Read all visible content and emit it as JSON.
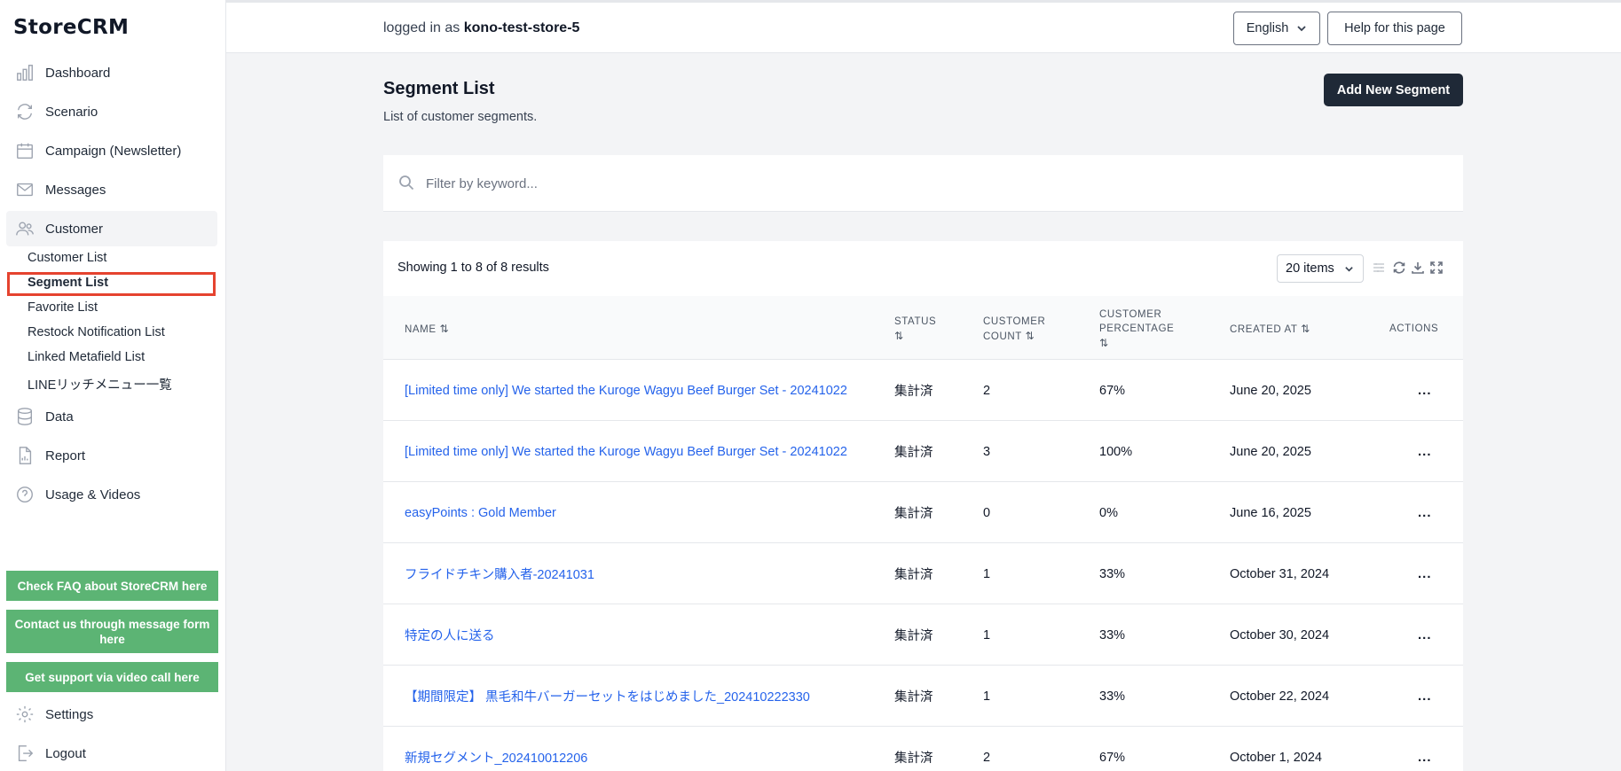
{
  "app": {
    "logo": "StoreCRM"
  },
  "sidebar": {
    "nav": [
      {
        "label": "Dashboard",
        "icon": "bar-chart-icon"
      },
      {
        "label": "Scenario",
        "icon": "refresh-icon"
      },
      {
        "label": "Campaign (Newsletter)",
        "icon": "calendar-icon"
      },
      {
        "label": "Messages",
        "icon": "mail-icon"
      },
      {
        "label": "Customer",
        "icon": "users-icon"
      }
    ],
    "customer_sub": [
      "Customer List",
      "Segment List",
      "Favorite List",
      "Restock Notification List",
      "Linked Metafield List",
      "LINEリッチメニュー一覧"
    ],
    "nav2": [
      {
        "label": "Data",
        "icon": "database-icon"
      },
      {
        "label": "Report",
        "icon": "document-chart-icon"
      },
      {
        "label": "Usage & Videos",
        "icon": "question-circle-icon"
      }
    ],
    "support_buttons": [
      "Check FAQ about StoreCRM here",
      "Contact us through message form here",
      "Get support via video call here"
    ],
    "bottom": [
      {
        "label": "Settings",
        "icon": "gear-icon"
      },
      {
        "label": "Logout",
        "icon": "logout-icon"
      }
    ]
  },
  "topbar": {
    "logged_prefix": "logged in as",
    "store": "kono-test-store-5",
    "language": "English",
    "help": "Help for this page"
  },
  "main": {
    "title": "Segment List",
    "subtitle": "List of customer segments.",
    "add_button": "Add New Segment",
    "filter_placeholder": "Filter by keyword...",
    "showing": "Showing 1 to 8 of 8 results",
    "items_per_page": "20 items"
  },
  "table": {
    "headers": {
      "name": "NAME",
      "status": "STATUS",
      "count_1": "CUSTOMER",
      "count_2": "COUNT",
      "pct_1": "CUSTOMER",
      "pct_2": "PERCENTAGE",
      "created": "CREATED AT",
      "actions": "ACTIONS"
    },
    "sort_glyph": "⇅",
    "rows": [
      {
        "name": "[Limited time only] We started the Kuroge Wagyu Beef Burger Set - 20241022",
        "status": "集計済",
        "count": "2",
        "pct": "67%",
        "created": "June 20, 2025",
        "actions": "..."
      },
      {
        "name": "[Limited time only] We started the Kuroge Wagyu Beef Burger Set - 20241022",
        "status": "集計済",
        "count": "3",
        "pct": "100%",
        "created": "June 20, 2025",
        "actions": "..."
      },
      {
        "name": "easyPoints : Gold Member",
        "status": "集計済",
        "count": "0",
        "pct": "0%",
        "created": "June 16, 2025",
        "actions": "..."
      },
      {
        "name": "フライドチキン購入者-20241031",
        "status": "集計済",
        "count": "1",
        "pct": "33%",
        "created": "October 31, 2024",
        "actions": "..."
      },
      {
        "name": "特定の人に送る",
        "status": "集計済",
        "count": "1",
        "pct": "33%",
        "created": "October 30, 2024",
        "actions": "..."
      },
      {
        "name": "【期間限定】 黒毛和牛バーガーセットをはじめました_202410222330",
        "status": "集計済",
        "count": "1",
        "pct": "33%",
        "created": "October 22, 2024",
        "actions": "..."
      },
      {
        "name": "新規セグメント_202410012206",
        "status": "集計済",
        "count": "2",
        "pct": "67%",
        "created": "October 1, 2024",
        "actions": "..."
      }
    ]
  },
  "colors": {
    "sidebar_bg": "#ffffff",
    "page_bg": "#f3f4f6",
    "link": "#2563eb",
    "primary_button": "#1f2937",
    "support_green": "#5cb474",
    "highlight_box": "#e5432f"
  }
}
